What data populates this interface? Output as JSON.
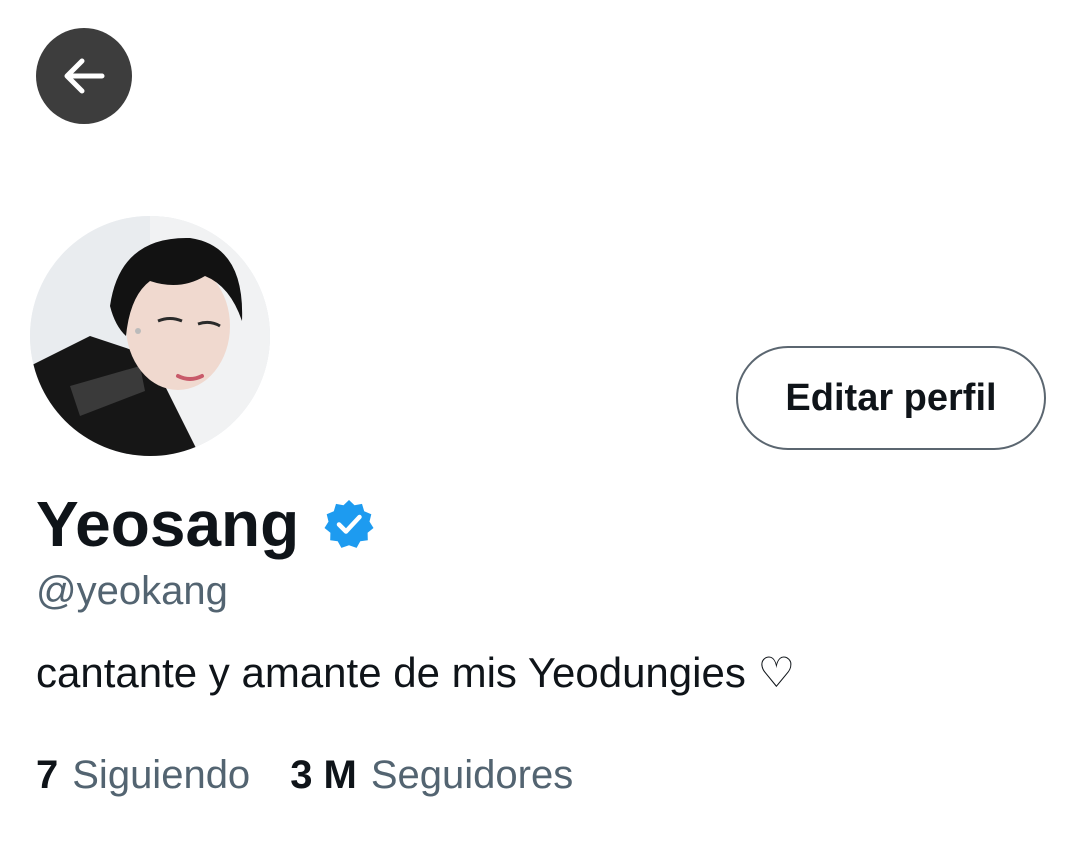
{
  "header": {
    "back_icon": "arrow-left-icon"
  },
  "profile": {
    "avatar_alt": "avatar",
    "edit_label": "Editar perfil",
    "name": "Yeosang",
    "verified_icon": "verified-badge-icon",
    "handle": "@yeokang",
    "bio": "cantante y amante de mis Yeodungies ♡"
  },
  "stats": {
    "following_count": "7",
    "following_label": "Siguiendo",
    "followers_count": "3 M",
    "followers_label": "Seguidores"
  },
  "colors": {
    "text_primary": "#0f1419",
    "text_secondary": "#536471",
    "verified_blue": "#1d9bf0",
    "back_button_bg": "#3d3d3d"
  }
}
